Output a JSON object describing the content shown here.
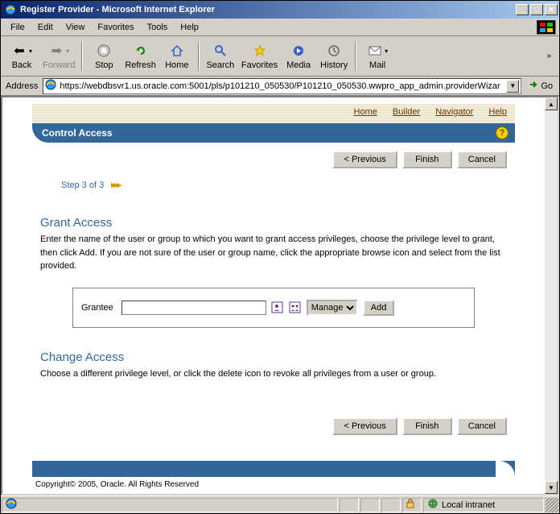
{
  "window": {
    "title": "Register Provider - Microsoft Internet Explorer"
  },
  "menu": {
    "file": "File",
    "edit": "Edit",
    "view": "View",
    "favorites": "Favorites",
    "tools": "Tools",
    "help": "Help"
  },
  "toolbar": {
    "back": "Back",
    "forward": "Forward",
    "stop": "Stop",
    "refresh": "Refresh",
    "home": "Home",
    "search": "Search",
    "favorites": "Favorites",
    "media": "Media",
    "history": "History",
    "mail": "Mail"
  },
  "address": {
    "label": "Address",
    "url": "https://webdbsvr1.us.oracle.com:5001/pls/p101210_050530/P101210_050530.wwpro_app_admin.providerWizar",
    "go": "Go"
  },
  "topnav": {
    "home": "Home",
    "builder": "Builder",
    "navigator": "Navigator",
    "help": "Help"
  },
  "header": {
    "title": "Control Access"
  },
  "buttons": {
    "previous": "< Previous",
    "finish": "Finish",
    "cancel": "Cancel",
    "add": "Add"
  },
  "wizard": {
    "step": "Step 3 of 3"
  },
  "grant": {
    "title": "Grant Access",
    "text": "Enter the name of the user or group to which you want to grant access privileges, choose the privilege level to grant, then click Add. If you are not sure of the user or group name, click the appropriate browse icon and select from the list provided.",
    "grantee_label": "Grantee",
    "privilege_selected": "Manage"
  },
  "change": {
    "title": "Change Access",
    "text": "Choose a different privilege level, or click the delete icon to revoke all privileges from a user or group."
  },
  "footer": {
    "copyright": "Copyright© 2005, Oracle. All Rights Reserved"
  },
  "status": {
    "zone": "Local intranet"
  }
}
